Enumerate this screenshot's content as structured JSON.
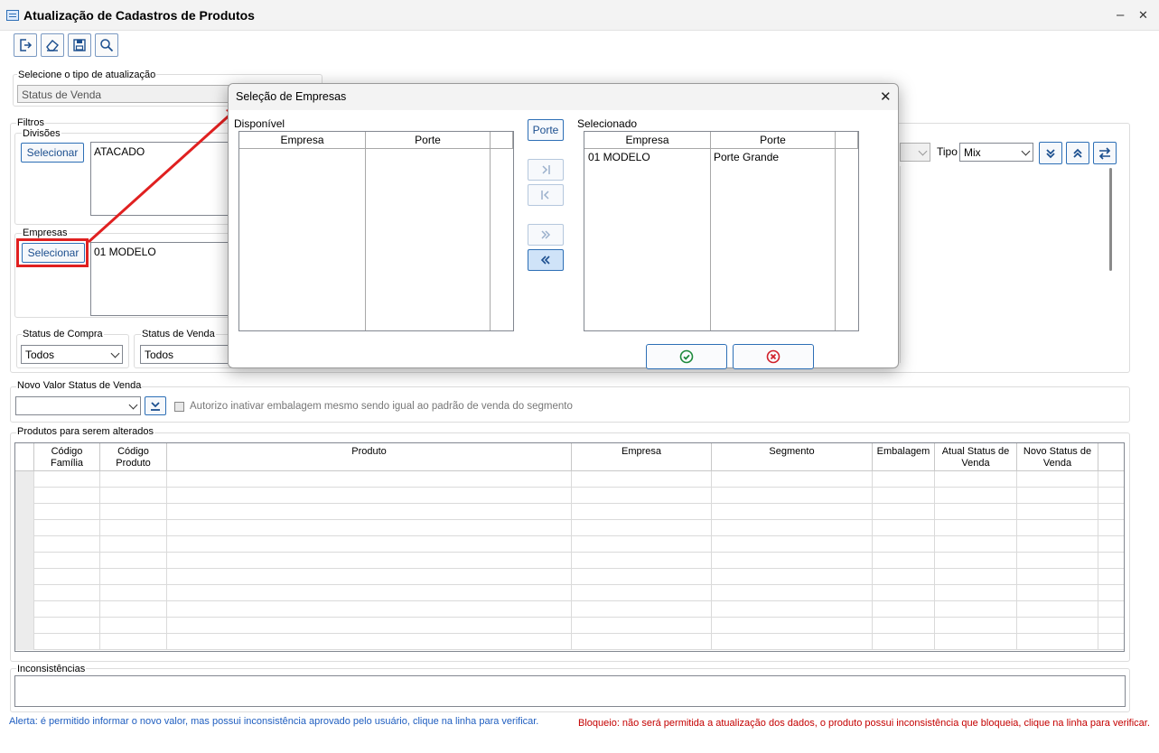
{
  "window": {
    "title": "Atualização de Cadastros de Produtos",
    "minimize": "–",
    "close": "✕"
  },
  "toolbar": {
    "icons": [
      "exit-icon",
      "eraser-icon",
      "save-icon",
      "search-icon"
    ]
  },
  "update_type": {
    "label": "Selecione o tipo de atualização",
    "value": "Status de Venda"
  },
  "filters": {
    "label": "Filtros",
    "divisions": {
      "label": "Divisões",
      "button": "Selecionar",
      "items": "ATACADO"
    },
    "companies": {
      "label": "Empresas",
      "button": "Selecionar",
      "items": "01 MODELO"
    },
    "purchase_status": {
      "label": "Status de Compra",
      "value": "Todos"
    },
    "sale_status": {
      "label": "Status de Venda",
      "value": "Todos"
    },
    "tipo": {
      "label": "Tipo",
      "value": "Mix"
    }
  },
  "new_value": {
    "label": "Novo Valor Status de Venda",
    "value": "",
    "checkbox_label": "Autorizo inativar embalagem mesmo sendo igual ao padrão de venda do segmento"
  },
  "products": {
    "label": "Produtos para serem alterados",
    "columns": [
      "Código Família",
      "Código Produto",
      "Produto",
      "Empresa",
      "Segmento",
      "Embalagem",
      "Atual Status de Venda",
      "Novo Status de Venda"
    ]
  },
  "inconsistencies": {
    "label": "Inconsistências"
  },
  "alerts": {
    "blue": "Alerta: é permitido informar o novo valor, mas possui inconsistência aprovado pelo usuário, clique na linha para verificar.",
    "red": "Bloqueio: não será permitida a atualização dos dados, o produto possui inconsistência que bloqueia, clique na linha para verificar."
  },
  "dialog": {
    "title": "Seleção de Empresas",
    "close": "✕",
    "available": {
      "label": "Disponível",
      "columns": [
        "Empresa",
        "Porte"
      ],
      "rows": []
    },
    "porte_button": "Porte",
    "selected": {
      "label": "Selecionado",
      "columns": [
        "Empresa",
        "Porte"
      ],
      "rows": [
        {
          "empresa": "01 MODELO",
          "porte": "Porte Grande"
        }
      ]
    }
  },
  "colors": {
    "accent": "#2d6fb6",
    "annotation": "#e02020",
    "ok_green": "#1e8a3c",
    "cancel_red": "#d0202a"
  }
}
